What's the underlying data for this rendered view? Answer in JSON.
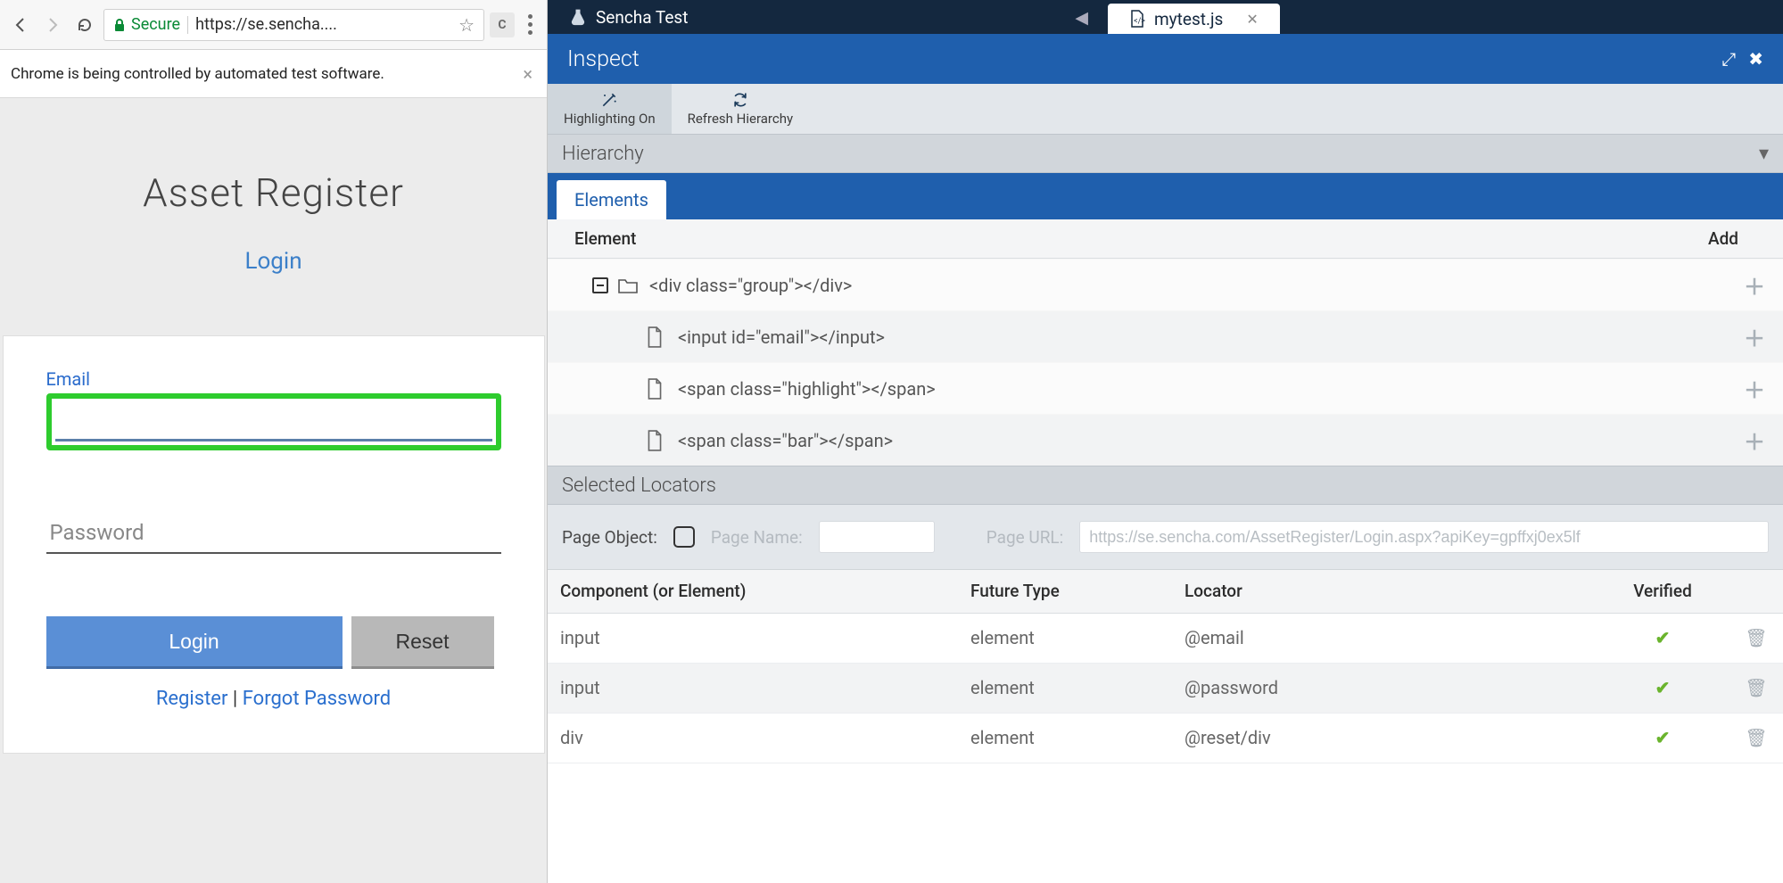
{
  "browser": {
    "secure_label": "Secure",
    "url": "https://se.sencha....",
    "banner": "Chrome is being controlled by automated test software.",
    "chrome_icon": "C"
  },
  "login": {
    "title": "Asset Register",
    "subtitle": "Login",
    "email_label": "Email",
    "email_value": "",
    "password_placeholder": "Password",
    "login_btn": "Login",
    "reset_btn": "Reset",
    "register": "Register",
    "separator": " | ",
    "forgot": "Forgot Password"
  },
  "ide": {
    "app_tab": "Sencha Test",
    "file_tab": "mytest.js",
    "inspect_title": "Inspect",
    "highlight_btn": "Highlighting On",
    "refresh_btn": "Refresh Hierarchy",
    "hierarchy_label": "Hierarchy",
    "elements_tab": "Elements",
    "element_col": "Element",
    "add_col": "Add",
    "tree": [
      {
        "depth": 0,
        "kind": "folder",
        "text": "<div class=\"group\"></div>"
      },
      {
        "depth": 1,
        "kind": "file",
        "text": "<input id=\"email\"></input>"
      },
      {
        "depth": 1,
        "kind": "file",
        "text": "<span class=\"highlight\"></span>"
      },
      {
        "depth": 1,
        "kind": "file",
        "text": "<span class=\"bar\"></span>"
      }
    ],
    "selected_locators": "Selected Locators",
    "page_object_label": "Page Object:",
    "page_name_label": "Page Name:",
    "page_url_label": "Page URL:",
    "page_url_value": "https://se.sencha.com/AssetRegister/Login.aspx?apiKey=gpffxj0ex5lf",
    "table": {
      "cols": [
        "Component (or Element)",
        "Future Type",
        "Locator",
        "Verified",
        ""
      ],
      "rows": [
        {
          "component": "input",
          "future": "element",
          "locator": "@email",
          "verified": true
        },
        {
          "component": "input",
          "future": "element",
          "locator": "@password",
          "verified": true
        },
        {
          "component": "div",
          "future": "element",
          "locator": "@reset/div",
          "verified": true
        }
      ]
    }
  }
}
